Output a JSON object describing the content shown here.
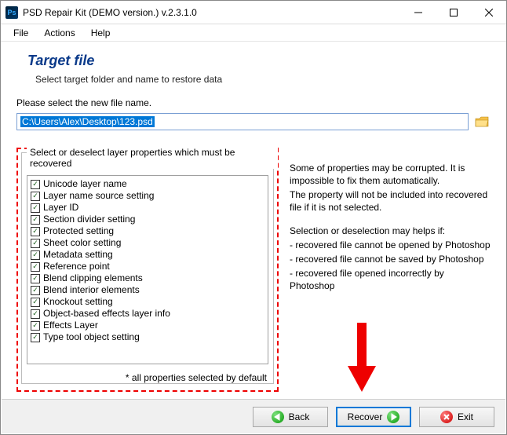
{
  "window": {
    "title": "PSD Repair Kit (DEMO version.) v.2.3.1.0"
  },
  "menu": {
    "file": "File",
    "actions": "Actions",
    "help": "Help"
  },
  "page": {
    "heading": "Target file",
    "subheading": "Select target folder and name to restore data",
    "selectLabel": "Please select the new file name.",
    "path": "C:\\Users\\Alex\\Desktop\\123.psd"
  },
  "layerBox": {
    "title": "Select or deselect layer properties which must be recovered",
    "items": [
      "Unicode layer name",
      "Layer name source setting",
      "Layer ID",
      "Section divider setting",
      "Protected setting",
      "Sheet color setting",
      "Metadata setting",
      "Reference point",
      "Blend clipping elements",
      "Blend interior elements",
      "Knockout setting",
      "Object-based effects layer info",
      "Effects Layer",
      "Type tool object setting"
    ],
    "note": "* all properties selected by default"
  },
  "info": {
    "line1": "Some of properties may be corrupted. It is impossible to fix them automatically.",
    "line2": "The property will not be included into recovered file if it is not selected.",
    "line3": "Selection or deselection may helps if:",
    "li1": "- recovered file cannot be opened by Photoshop",
    "li2": "- recovered file cannot be saved by Photoshop",
    "li3": "- recovered file opened incorrectly by Photoshop"
  },
  "buttons": {
    "back": "Back",
    "recover": "Recover",
    "exit": "Exit"
  }
}
